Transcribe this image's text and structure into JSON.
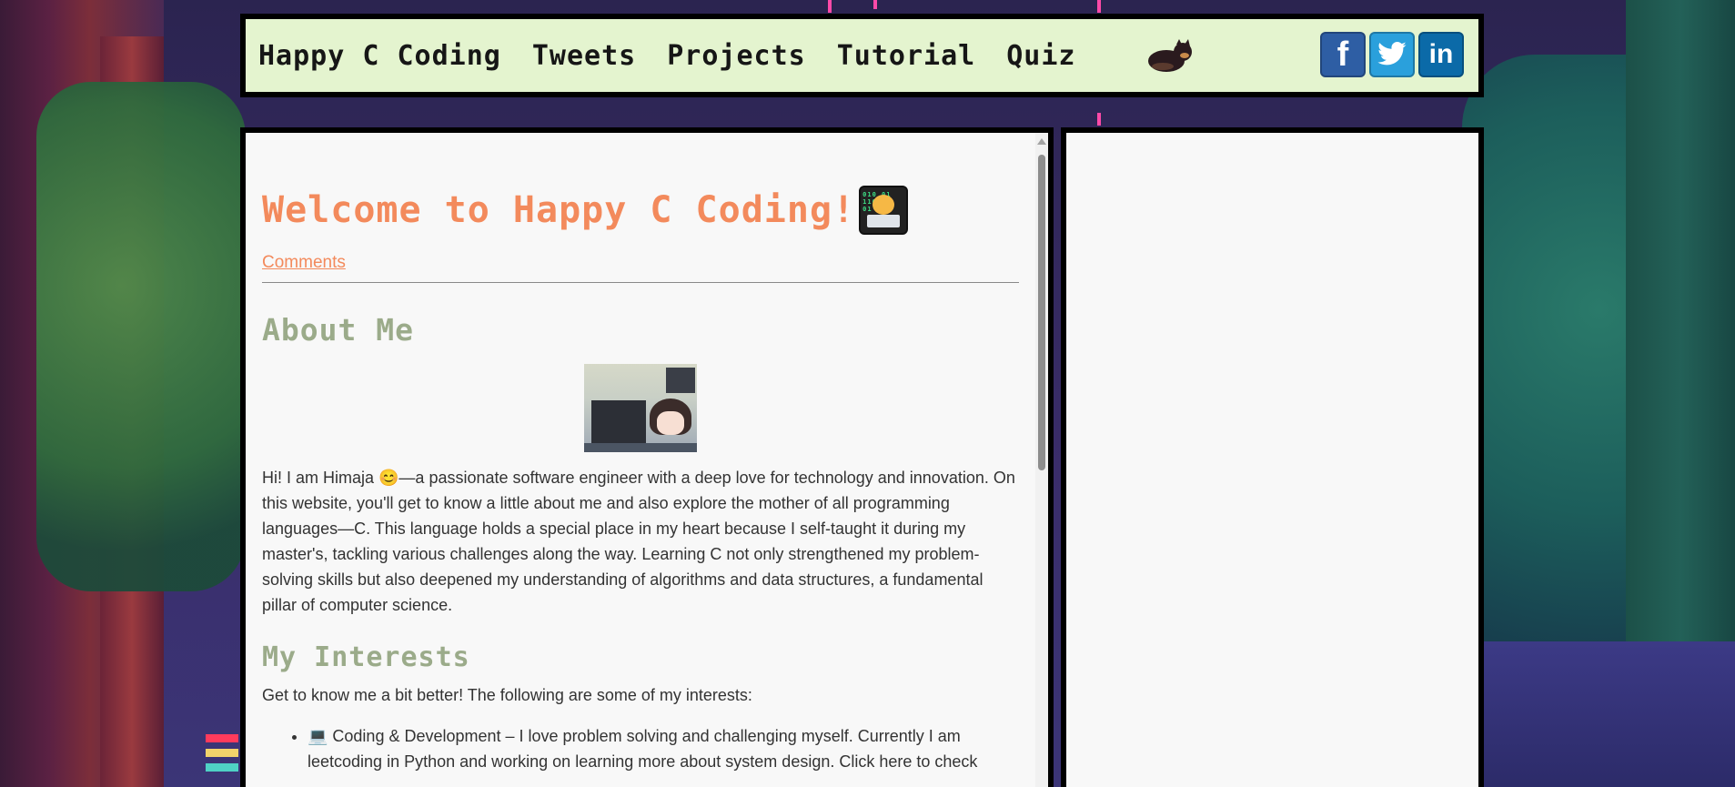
{
  "nav": {
    "links": [
      "Happy C Coding",
      "Tweets",
      "Projects",
      "Tutorial",
      "Quiz"
    ],
    "social": [
      {
        "name": "facebook",
        "glyph": "f",
        "color": "#2e5ea4"
      },
      {
        "name": "twitter",
        "glyph": "🐦",
        "color": "#2aa0dc"
      },
      {
        "name": "linkedin",
        "glyph": "in",
        "color": "#0b6aa8"
      }
    ]
  },
  "main": {
    "title": "Welcome to Happy C Coding!",
    "comments_label": "Comments",
    "about_heading": "About Me",
    "about_text": "Hi! I am Himaja 😊—a passionate software engineer with a deep love for technology and innovation. On this website, you'll get to know a little about me and also explore the mother of all programming languages—C. This language holds a special place in my heart because I self-taught it during my master's, tackling various challenges along the way. Learning C not only strengthened my problem-solving skills but also deepened my understanding of algorithms and data structures, a fundamental pillar of computer science.",
    "interests_heading": "My Interests",
    "interests_intro": "Get to know me a bit better! The following are some of my interests:",
    "interests": [
      "💻 Coding & Development – I love problem solving and challenging myself. Currently I am leetcoding in Python and working on learning more about system design. Click here to check"
    ]
  },
  "colors": {
    "accent": "#f38a5c",
    "heading": "#9bab8a",
    "nav_bg": "#e4f4cf"
  }
}
